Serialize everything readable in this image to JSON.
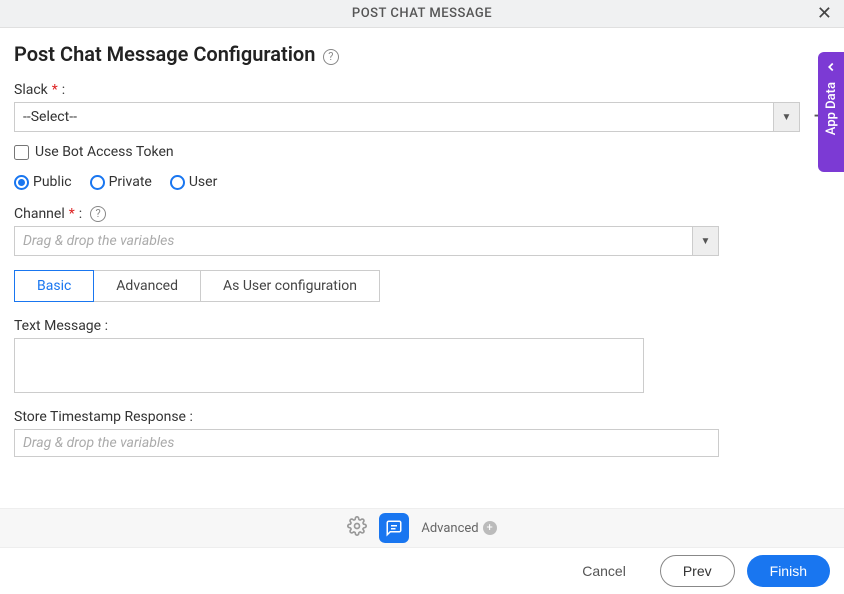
{
  "header": {
    "title": "POST CHAT MESSAGE"
  },
  "page": {
    "title": "Post Chat Message Configuration"
  },
  "slack": {
    "label": "Slack",
    "selected": "--Select--"
  },
  "botToken": {
    "label": "Use Bot Access Token"
  },
  "visibility": [
    {
      "label": "Public",
      "selected": true
    },
    {
      "label": "Private",
      "selected": false
    },
    {
      "label": "User",
      "selected": false
    }
  ],
  "channel": {
    "label": "Channel",
    "placeholder": "Drag & drop the variables"
  },
  "tabs": [
    {
      "label": "Basic",
      "active": true
    },
    {
      "label": "Advanced",
      "active": false
    },
    {
      "label": "As User configuration",
      "active": false
    }
  ],
  "textMessage": {
    "label": "Text Message :"
  },
  "timestamp": {
    "label": "Store Timestamp Response :",
    "placeholder": "Drag & drop the variables"
  },
  "bottomBar": {
    "advanced": "Advanced"
  },
  "footer": {
    "cancel": "Cancel",
    "prev": "Prev",
    "finish": "Finish"
  },
  "sideTab": {
    "label": "App Data"
  }
}
